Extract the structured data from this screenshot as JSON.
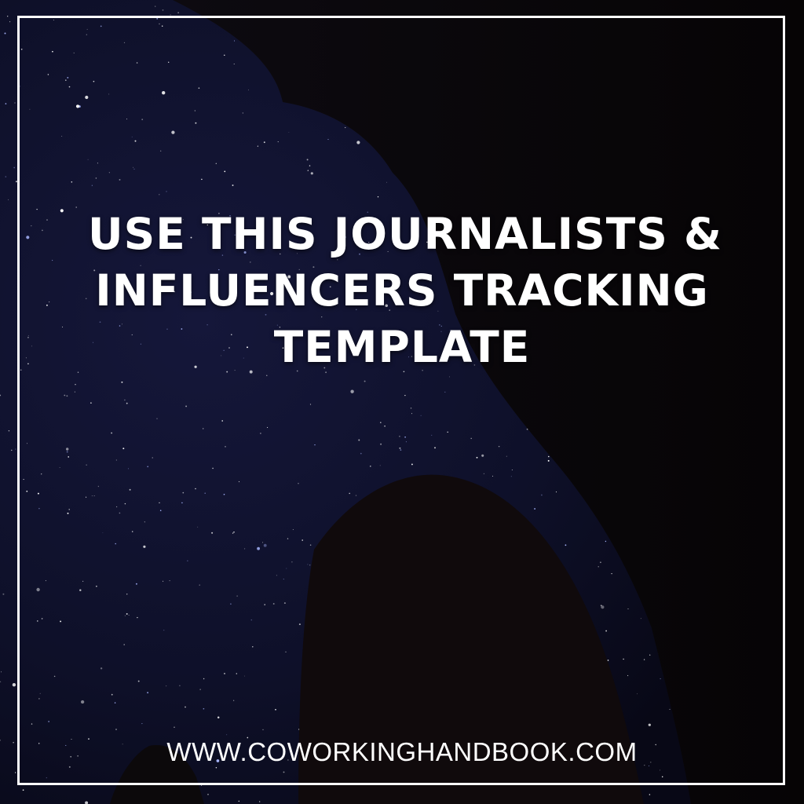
{
  "headline": {
    "line1": "USE THIS JOURNALISTS &",
    "line2": "INFLUENCERS TRACKING",
    "line3": "TEMPLATE"
  },
  "footer": {
    "url": "WWW.COWORKINGHANDBOOK.COM"
  },
  "colors": {
    "text": "#ffffff",
    "frame": "#ffffff",
    "sky": "#0e1030",
    "rock": "#0b0709"
  }
}
